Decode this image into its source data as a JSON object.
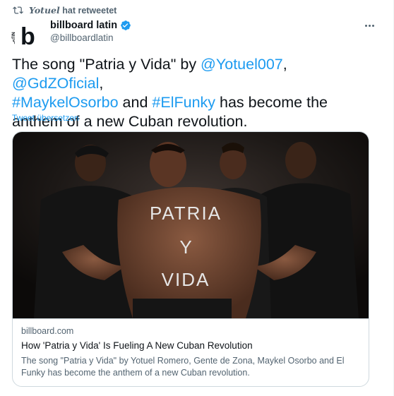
{
  "retweet": {
    "user": "Yotuel",
    "label": "hat retweetet"
  },
  "author": {
    "name": "billboard latin",
    "handle": "@billboardlatin",
    "logo_letter": "b",
    "logo_side_text": "LATIN"
  },
  "tweet": {
    "p1": "The song \"Patria y Vida\" by ",
    "m1": "@Yotuel007",
    "p2": ", ",
    "m2": "@GdZOficial",
    "p3": ",",
    "m3": "#MaykelOsorbo",
    "p4": " and ",
    "m4": "#ElFunky",
    "p5": " has become the anthem of a new Cuban revolution."
  },
  "translate_label": "Tweet übersetzen",
  "card": {
    "image_chest_text": [
      "PATRIA",
      "Y",
      "VIDA"
    ],
    "domain": "billboard.com",
    "title": "How 'Patria y Vida' Is Fueling A New Cuban Revolution",
    "description": "The song \"Patria y Vida\" by Yotuel Romero, Gente de Zona, Maykel Osorbo and El Funky has become the anthem of a new Cuban revolution."
  },
  "colors": {
    "accent": "#1d9bf0",
    "verified": "#1d9bf0",
    "text": "#0f1419",
    "muted": "#536471"
  }
}
